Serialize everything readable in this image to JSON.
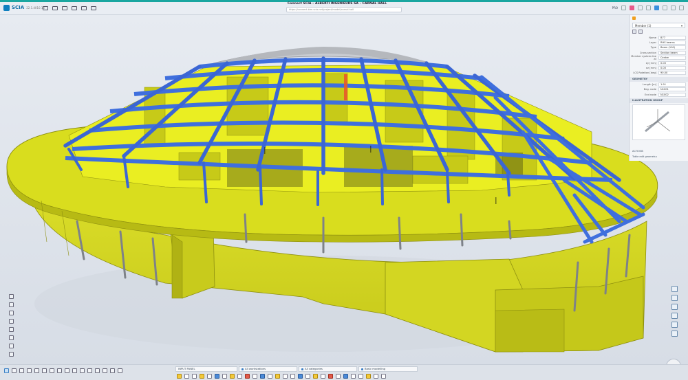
{
  "app": {
    "logo_name": "SCIA",
    "version": "22.1.4010.16",
    "window_title": "Connect SCIA – ALBERTI INGENIEURS SA – CARNAL HALL",
    "url_placeholder": "https://connect.bim.scia.net/project/model/carnal-hall",
    "zoom_label": "PRO"
  },
  "properties": {
    "selection": "Member (1)",
    "rows": [
      {
        "key": "Name",
        "value": "B77"
      },
      {
        "key": "Layer",
        "value": "RHS beams"
      },
      {
        "key": "Type",
        "value": "Beam (100)"
      },
      {
        "key": "Cross-section",
        "value": "Section beam"
      },
      {
        "key": "Member system-line at",
        "value": "Centre"
      },
      {
        "key": "ey [mm]",
        "value": "0.00"
      },
      {
        "key": "ez [mm]",
        "value": "0.00"
      },
      {
        "key": "LCS Rotation [deg]",
        "value": "90.00"
      }
    ],
    "geometry_section": "GEOMETRY",
    "geometry_rows": [
      {
        "key": "Length [m]",
        "value": "1.91"
      },
      {
        "key": "Beg. node",
        "value": "N1001"
      },
      {
        "key": "End node",
        "value": "N1002"
      }
    ],
    "illustration_section": "ILLUSTRATION GROUP",
    "actions_label": "ACTIONS",
    "action_item": "Table edit geometry"
  },
  "bottom_bar": {
    "input_panel": "INPUT PANEL",
    "workstation": "All workstations",
    "categories": "All categories",
    "mode": "Basic modelling"
  },
  "colors": {
    "concrete": "#d9dd1e",
    "steel": "#3f6fdd",
    "roof": "#c9ccd1",
    "background": "#dfe4ec"
  }
}
